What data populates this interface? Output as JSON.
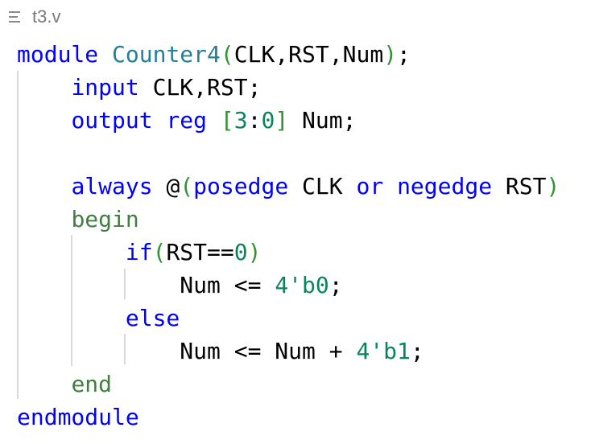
{
  "tab": {
    "file_name": "t3.v",
    "icon": "lines-icon"
  },
  "lines": [
    {
      "tokens": [
        {
          "t": "module",
          "c": "kw"
        },
        {
          "t": " ",
          "c": "id"
        },
        {
          "t": "Counter4",
          "c": "ty"
        },
        {
          "t": "(",
          "c": "br"
        },
        {
          "t": "CLK",
          "c": "id"
        },
        {
          "t": ",",
          "c": "id"
        },
        {
          "t": "RST",
          "c": "id"
        },
        {
          "t": ",",
          "c": "id"
        },
        {
          "t": "Num",
          "c": "id"
        },
        {
          "t": ")",
          "c": "br"
        },
        {
          "t": ";",
          "c": "id"
        }
      ]
    },
    {
      "tokens": [
        {
          "t": "    ",
          "c": "id"
        },
        {
          "t": "input",
          "c": "kw"
        },
        {
          "t": " CLK,RST;",
          "c": "id"
        }
      ]
    },
    {
      "tokens": [
        {
          "t": "    ",
          "c": "id"
        },
        {
          "t": "output",
          "c": "kw"
        },
        {
          "t": " ",
          "c": "id"
        },
        {
          "t": "reg",
          "c": "kw"
        },
        {
          "t": " ",
          "c": "id"
        },
        {
          "t": "[",
          "c": "br"
        },
        {
          "t": "3",
          "c": "num"
        },
        {
          "t": ":",
          "c": "id"
        },
        {
          "t": "0",
          "c": "num"
        },
        {
          "t": "]",
          "c": "br"
        },
        {
          "t": " Num;",
          "c": "id"
        }
      ]
    },
    {
      "tokens": []
    },
    {
      "tokens": [
        {
          "t": "    ",
          "c": "id"
        },
        {
          "t": "always",
          "c": "kw"
        },
        {
          "t": " ",
          "c": "id"
        },
        {
          "t": "@",
          "c": "id"
        },
        {
          "t": "(",
          "c": "br"
        },
        {
          "t": "posedge",
          "c": "kw"
        },
        {
          "t": " CLK ",
          "c": "id"
        },
        {
          "t": "or",
          "c": "kw"
        },
        {
          "t": " ",
          "c": "id"
        },
        {
          "t": "negedge",
          "c": "kw"
        },
        {
          "t": " RST",
          "c": "id"
        },
        {
          "t": ")",
          "c": "br"
        }
      ]
    },
    {
      "tokens": [
        {
          "t": "    ",
          "c": "id"
        },
        {
          "t": "begin",
          "c": "blk"
        }
      ]
    },
    {
      "tokens": [
        {
          "t": "        ",
          "c": "id"
        },
        {
          "t": "if",
          "c": "kw"
        },
        {
          "t": "(",
          "c": "br"
        },
        {
          "t": "RST==",
          "c": "id"
        },
        {
          "t": "0",
          "c": "num"
        },
        {
          "t": ")",
          "c": "br"
        }
      ]
    },
    {
      "tokens": [
        {
          "t": "            ",
          "c": "id"
        },
        {
          "t": "Num <= ",
          "c": "id"
        },
        {
          "t": "4'b0",
          "c": "num"
        },
        {
          "t": ";",
          "c": "id"
        }
      ]
    },
    {
      "tokens": [
        {
          "t": "        ",
          "c": "id"
        },
        {
          "t": "else",
          "c": "kw"
        }
      ]
    },
    {
      "tokens": [
        {
          "t": "            ",
          "c": "id"
        },
        {
          "t": "Num <= Num + ",
          "c": "id"
        },
        {
          "t": "4'b1",
          "c": "num"
        },
        {
          "t": ";",
          "c": "id"
        }
      ]
    },
    {
      "tokens": [
        {
          "t": "    ",
          "c": "id"
        },
        {
          "t": "end",
          "c": "blk"
        }
      ]
    },
    {
      "tokens": [
        {
          "t": "endmodule",
          "c": "kw"
        }
      ]
    }
  ]
}
